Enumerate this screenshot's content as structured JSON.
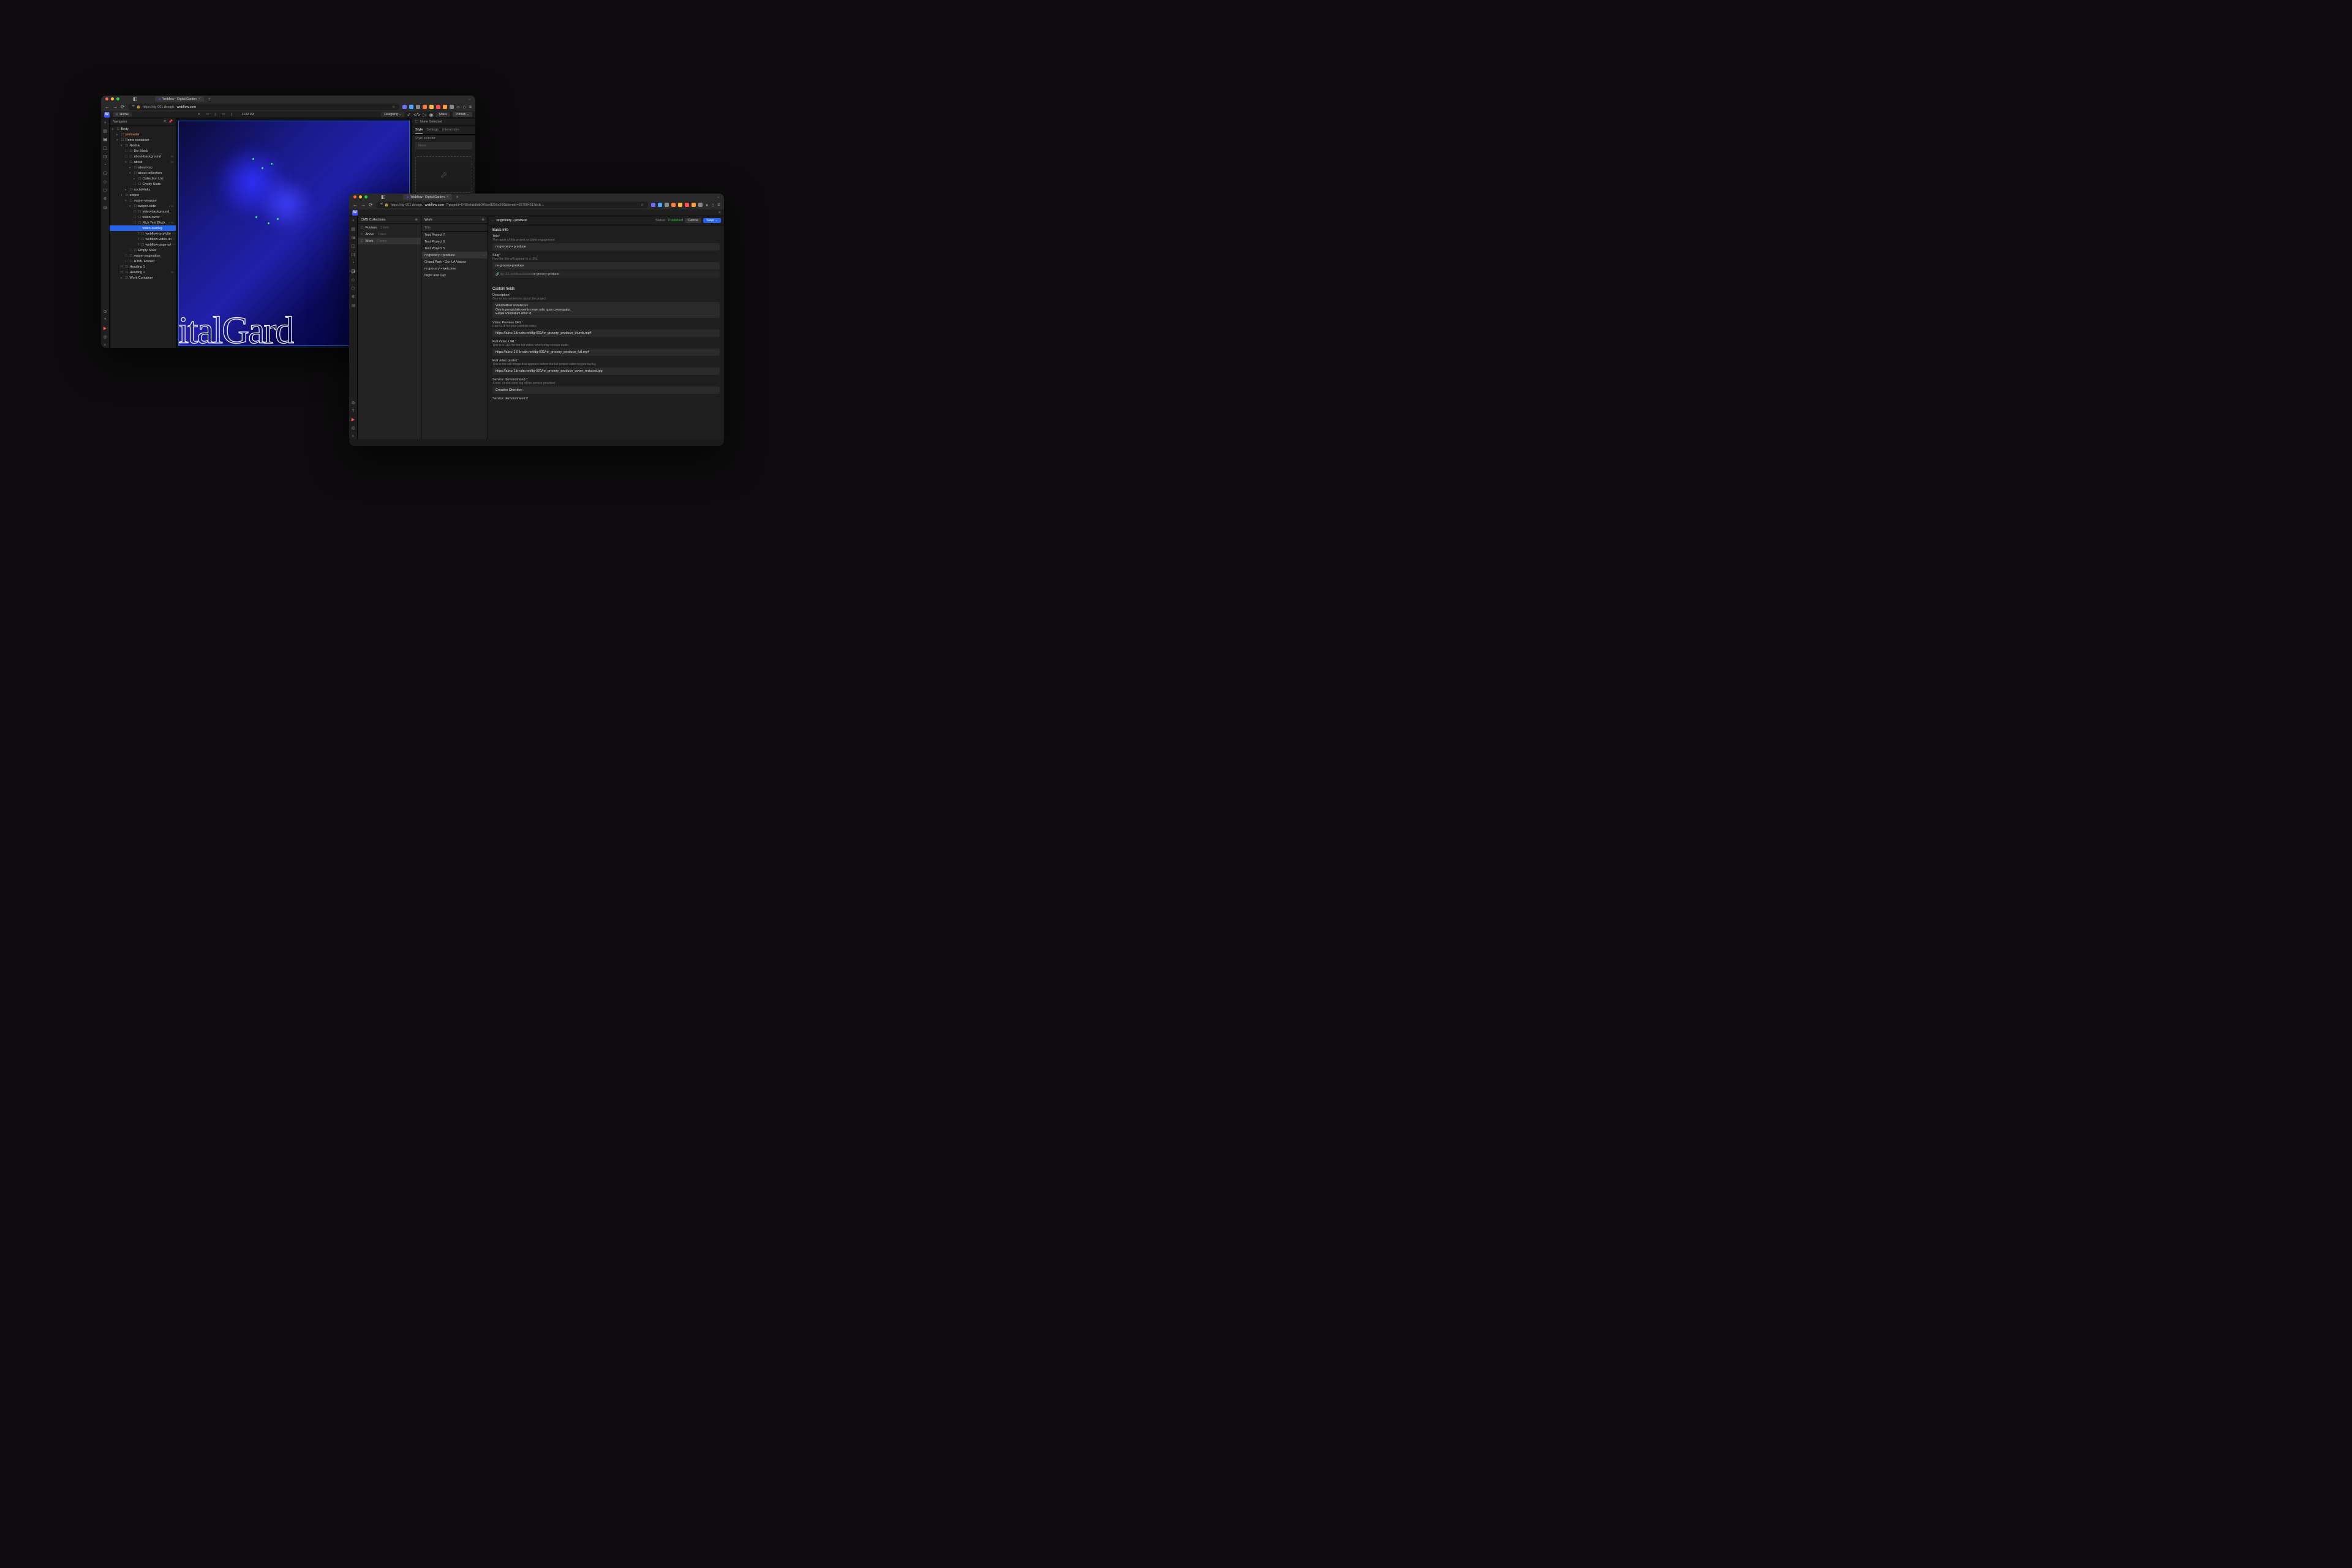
{
  "window1": {
    "tab_title": "Webflow - Digital Garden",
    "url_prefix": "https://dg-001.design.",
    "url_host": "webflow.com",
    "home_label": "Home",
    "breakpoint_size": "1122 PX",
    "designing_label": "Designing",
    "share_label": "Share",
    "publish_label": "Publish",
    "navigator_label": "Navigator",
    "tree": [
      {
        "label": "Body",
        "indent": 0,
        "icon": "▸"
      },
      {
        "label": "preloader",
        "indent": 1,
        "icon": "▸",
        "cls": "pre"
      },
      {
        "label": "Home container",
        "indent": 1,
        "icon": "▾"
      },
      {
        "label": "Navbar",
        "indent": 2,
        "icon": "▾"
      },
      {
        "label": "Div Block",
        "indent": 3,
        "icon": "☐"
      },
      {
        "label": "about-background",
        "indent": 3,
        "icon": "☐",
        "pct": "%"
      },
      {
        "label": "about",
        "indent": 3,
        "icon": "▾",
        "pct": "%"
      },
      {
        "label": "about-top",
        "indent": 4,
        "icon": "▸"
      },
      {
        "label": "about-collection",
        "indent": 4,
        "icon": "▾"
      },
      {
        "label": "Collection List",
        "indent": 5,
        "icon": "▸"
      },
      {
        "label": "Empty State",
        "indent": 5,
        "icon": "☐"
      },
      {
        "label": "social-links",
        "indent": 3,
        "icon": "▸"
      },
      {
        "label": "swiper",
        "indent": 2,
        "icon": "▾"
      },
      {
        "label": "swiper-wrapper",
        "indent": 3,
        "icon": "▾"
      },
      {
        "label": "swiper-slide",
        "indent": 4,
        "icon": "▾",
        "pct": "+ %"
      },
      {
        "label": "video-background",
        "indent": 5,
        "icon": "☐"
      },
      {
        "label": "video-cover",
        "indent": 5,
        "icon": "☐"
      },
      {
        "label": "Rich Text Block",
        "indent": 5,
        "icon": "☐",
        "pct": "+ %"
      },
      {
        "label": "video-overlay",
        "indent": 5,
        "icon": "▾",
        "cls": "sel"
      },
      {
        "label": "webflow-proj-title",
        "indent": 6,
        "icon": "T",
        "pct": "+ %"
      },
      {
        "label": "webflow-video-url",
        "indent": 6,
        "icon": "T",
        "pct": "+ %"
      },
      {
        "label": "webflow-page-url",
        "indent": 6,
        "icon": "T",
        "pct": "+ %"
      },
      {
        "label": "Empty State",
        "indent": 4,
        "icon": "☐"
      },
      {
        "label": "swiper-pagination",
        "indent": 3,
        "icon": "☐"
      },
      {
        "label": "HTML Embed",
        "indent": 3,
        "icon": "☐"
      },
      {
        "label": "Heading 1",
        "indent": 2,
        "icon": "H"
      },
      {
        "label": "Heading 1",
        "indent": 2,
        "icon": "H",
        "pct": "%"
      },
      {
        "label": "Work Container",
        "indent": 2,
        "icon": "▸"
      }
    ],
    "hero_text": "gitalGard",
    "inspector": {
      "none_selected": "None Selected",
      "tabs": [
        "Style",
        "Settings",
        "Interactions"
      ],
      "style_selector_label": "Style selector",
      "style_selector_value": "None"
    }
  },
  "window2": {
    "tab_title": "Webflow - Digital Garden",
    "url_prefix": "https://dg-001.design.",
    "url_host": "webflow.com",
    "url_suffix": "/?pageId=6485efab8db049ae8256a566&itemId=657604513dcb…",
    "cms_collections_label": "CMS Collections",
    "collections": [
      {
        "label": "Footers",
        "count": "1 item",
        "icon": "☐"
      },
      {
        "label": "About",
        "count": "1 item",
        "icon": "☐"
      },
      {
        "label": "Work",
        "count": "7 items",
        "icon": "☐",
        "sel": true
      }
    ],
    "items_header": "Work",
    "items_subhead": "Title",
    "items": [
      {
        "label": "Test Project 7"
      },
      {
        "label": "Test Project 6"
      },
      {
        "label": "Test Project 5"
      },
      {
        "label": "re:grocery • produce",
        "sel": true
      },
      {
        "label": "Grand Park • Our LA Voices"
      },
      {
        "label": "re:grocery • welcome"
      },
      {
        "label": "Night and Day"
      }
    ],
    "editor": {
      "breadcrumb": "←",
      "title": "re:grocery • produce",
      "status_label": "Status:",
      "status_value": "Published",
      "cancel_label": "Cancel",
      "save_label": "Save",
      "basic_info": "Basic info",
      "title_field": {
        "label": "Title",
        "help": "The name of this project or client engagement",
        "value": "re:grocery • produce"
      },
      "slug_field": {
        "label": "Slug",
        "help": "How the title will appear in a URL",
        "value": "re-grocery-produce",
        "preview_prefix": "dg-001.webflow.io/work/",
        "preview_dyn": "re-grocery-produce"
      },
      "custom_fields": "Custom fields",
      "desc_field": {
        "label": "Description",
        "help": "One or two sentences about the project",
        "value": "Voluptatibus ut delectus.\nOmnis perspiciatis omnis rerum odio quos consequatur.\nEaque voluptatum dolor id."
      },
      "video_preview": {
        "label": "Video Preview URL",
        "help": "Raw URL for your portfolio video",
        "value": "https://abru-1.b-cdn.net/dg-001/re_grocery_produce_thumb.mp4"
      },
      "full_video": {
        "label": "Full Video URL",
        "help": "This is a URL for the full video, which may contain audio.",
        "value": "https://abru-1.0-b-cdn.net/dg-001/re_grocery_produce_full.mp4"
      },
      "poster": {
        "label": "Full video poster",
        "help": "This is the still image that appears before the full project video begins to play",
        "value": "https://abru-1.b-cdn.net/dg-001/re_grocery_produce_cover_reduced.jpg"
      },
      "service1": {
        "label": "Service demonstrated 1",
        "help": "A one- or two-word tag of the service provided",
        "value": "Creative Direction"
      },
      "service2": {
        "label": "Service demonstrated 2"
      }
    }
  },
  "ext_colors": [
    "#6c6cff",
    "#4ba3ff",
    "#888",
    "#ff7b39",
    "#ffb839",
    "#ff4d4d",
    "#ff9e39",
    "#888"
  ]
}
